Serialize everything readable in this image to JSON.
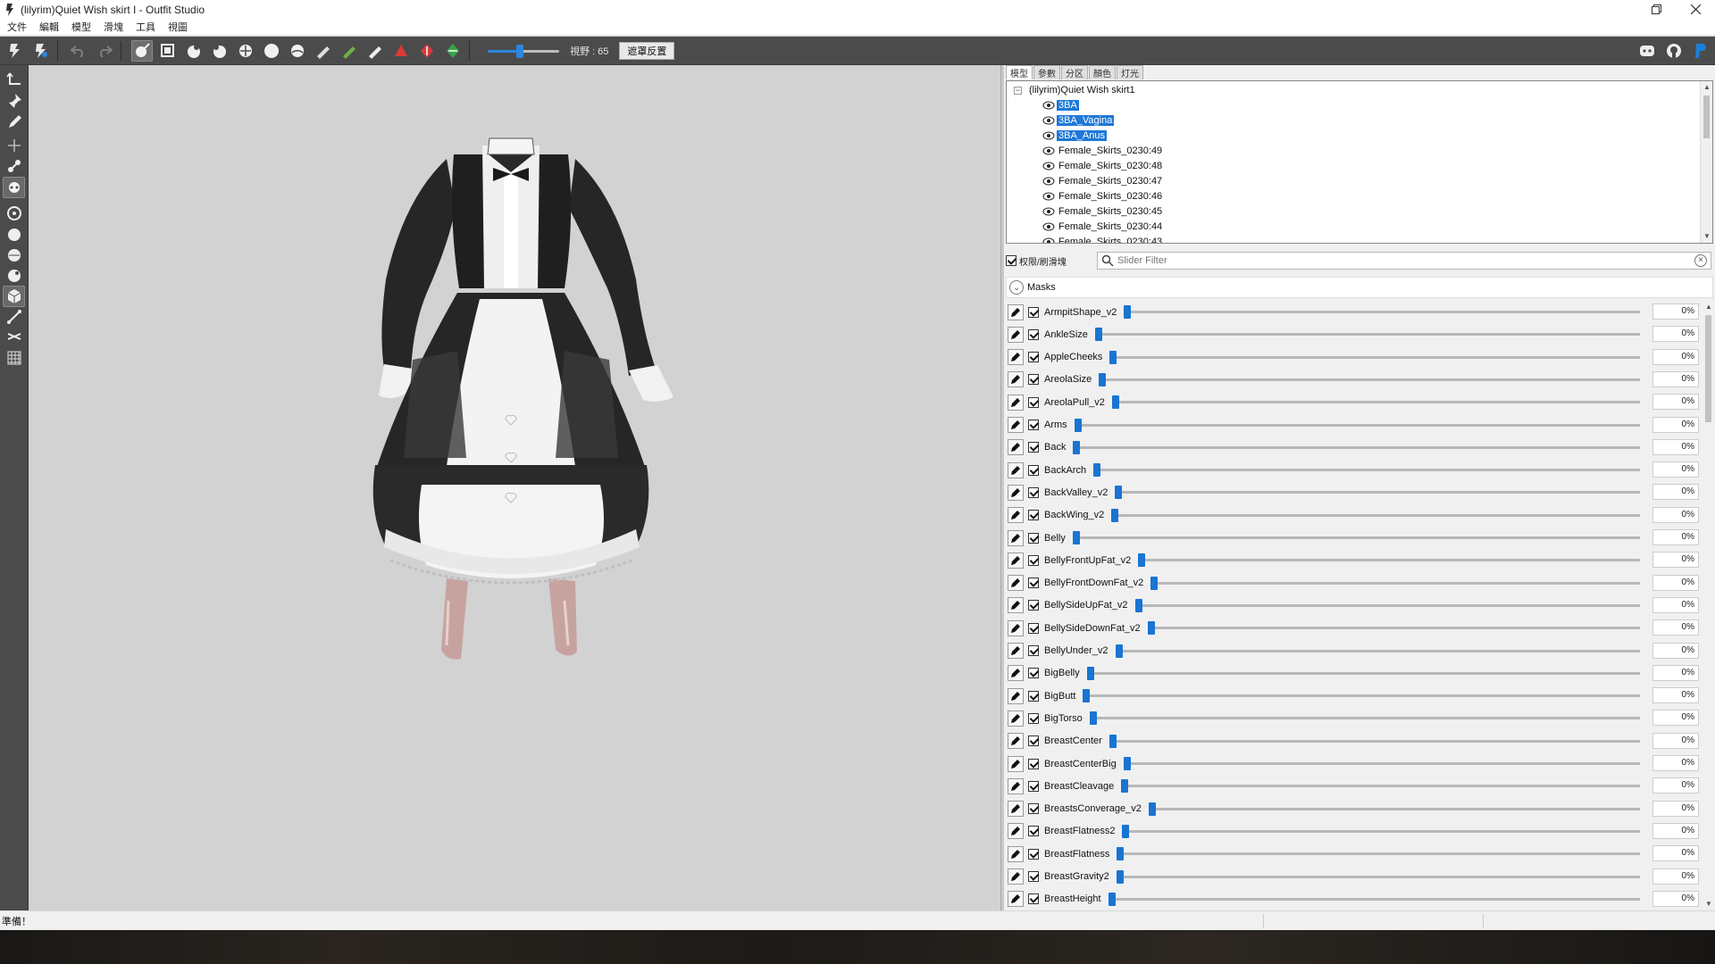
{
  "window": {
    "title": "(lilyrim)Quiet Wish skirt I - Outfit Studio",
    "controls": [
      "restore",
      "close"
    ]
  },
  "menu": [
    "文件",
    "編輯",
    "模型",
    "滑塊",
    "工具",
    "視圖"
  ],
  "toolbar": {
    "fov_label": "視野 : 65",
    "fov_value": 65,
    "reset_label": "遮罩反置"
  },
  "tabs": [
    "模型",
    "參數",
    "分区",
    "顏色",
    "灯光"
  ],
  "tree": {
    "root": "(lilyrim)Quiet Wish skirt1",
    "items": [
      {
        "label": "3BA",
        "selected": true
      },
      {
        "label": "3BA_Vagina",
        "selected": true
      },
      {
        "label": "3BA_Anus",
        "selected": true
      },
      {
        "label": "Female_Skirts_0230:49",
        "selected": false
      },
      {
        "label": "Female_Skirts_0230:48",
        "selected": false
      },
      {
        "label": "Female_Skirts_0230:47",
        "selected": false
      },
      {
        "label": "Female_Skirts_0230:46",
        "selected": false
      },
      {
        "label": "Female_Skirts_0230:45",
        "selected": false
      },
      {
        "label": "Female_Skirts_0230:44",
        "selected": false
      },
      {
        "label": "Female_Skirts_0230:43",
        "selected": false
      }
    ]
  },
  "brush_toggle": "权限/刷滑塊",
  "filter": {
    "placeholder": "Slider Filter",
    "value": ""
  },
  "masks_label": "Masks",
  "sliders": [
    {
      "name": "ArmpitShape_v2",
      "value": "0%"
    },
    {
      "name": "AnkleSize",
      "value": "0%"
    },
    {
      "name": "AppleCheeks",
      "value": "0%"
    },
    {
      "name": "AreolaSize",
      "value": "0%"
    },
    {
      "name": "AreolaPull_v2",
      "value": "0%"
    },
    {
      "name": "Arms",
      "value": "0%"
    },
    {
      "name": "Back",
      "value": "0%"
    },
    {
      "name": "BackArch",
      "value": "0%"
    },
    {
      "name": "BackValley_v2",
      "value": "0%"
    },
    {
      "name": "BackWing_v2",
      "value": "0%"
    },
    {
      "name": "Belly",
      "value": "0%"
    },
    {
      "name": "BellyFrontUpFat_v2",
      "value": "0%"
    },
    {
      "name": "BellyFrontDownFat_v2",
      "value": "0%"
    },
    {
      "name": "BellySideUpFat_v2",
      "value": "0%"
    },
    {
      "name": "BellySideDownFat_v2",
      "value": "0%"
    },
    {
      "name": "BellyUnder_v2",
      "value": "0%"
    },
    {
      "name": "BigBelly",
      "value": "0%"
    },
    {
      "name": "BigButt",
      "value": "0%"
    },
    {
      "name": "BigTorso",
      "value": "0%"
    },
    {
      "name": "BreastCenter",
      "value": "0%"
    },
    {
      "name": "BreastCenterBig",
      "value": "0%"
    },
    {
      "name": "BreastCleavage",
      "value": "0%"
    },
    {
      "name": "BreastsConverage_v2",
      "value": "0%"
    },
    {
      "name": "BreastFlatness2",
      "value": "0%"
    },
    {
      "name": "BreastFlatness",
      "value": "0%"
    },
    {
      "name": "BreastGravity2",
      "value": "0%"
    },
    {
      "name": "BreastHeight",
      "value": "0%"
    }
  ],
  "status": "準備！",
  "colors": {
    "accent": "#1a74d2",
    "toolbar": "#4b4b4b",
    "viewport": "#d2d2d2"
  }
}
